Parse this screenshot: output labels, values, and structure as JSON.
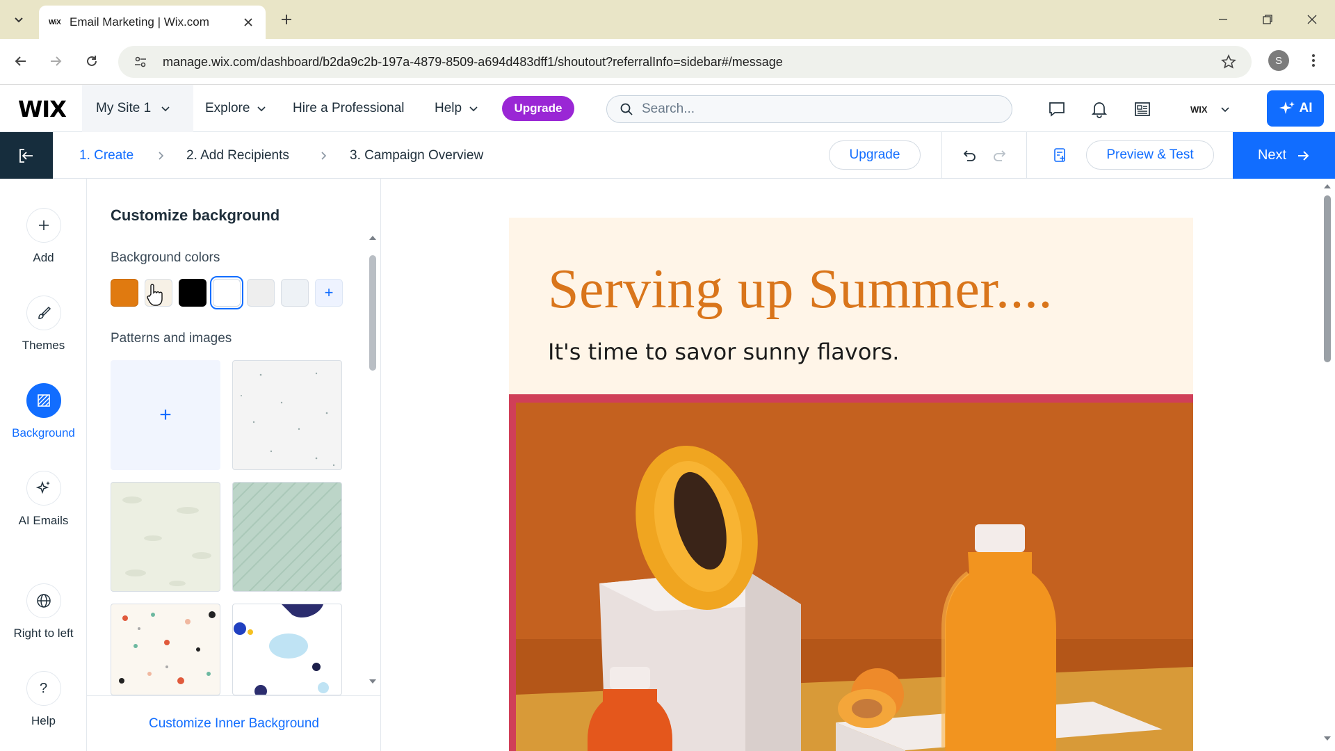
{
  "browser": {
    "tab_title": "Email Marketing | Wix.com",
    "tab_favicon": "WiX",
    "url": "manage.wix.com/dashboard/b2da9c2b-197a-4879-8509-a694d483dff1/shoutout?referralInfo=sidebar#/message",
    "profile_initial": "S"
  },
  "wix_topbar": {
    "logo": "WIX",
    "site_name": "My Site 1",
    "explore": "Explore",
    "hire": "Hire a Professional",
    "help": "Help",
    "upgrade": "Upgrade",
    "search_placeholder": "Search...",
    "account": "WIX",
    "ai_button": "AI"
  },
  "steps": {
    "create": "1. Create",
    "recipients": "2. Add Recipients",
    "overview": "3. Campaign Overview",
    "upgrade": "Upgrade",
    "preview": "Preview & Test",
    "next": "Next"
  },
  "left_rail": [
    {
      "label": "Add",
      "icon": "plus-icon"
    },
    {
      "label": "Themes",
      "icon": "brush-icon"
    },
    {
      "label": "Background",
      "icon": "background-icon",
      "active": true
    },
    {
      "label": "AI Emails",
      "icon": "sparkle-icon"
    },
    {
      "label": "Right to left",
      "icon": "globe-icon"
    },
    {
      "label": "Help",
      "icon": "question-icon"
    }
  ],
  "panel": {
    "title": "Customize background",
    "colors_label": "Background colors",
    "patterns_label": "Patterns and images",
    "footer_link": "Customize Inner Background",
    "swatches": [
      "#e07a10",
      "#f7f1e6",
      "#000000",
      "#ffffff",
      "#eeeeee",
      "#eef2f6"
    ],
    "selected_swatch": "#ffffff"
  },
  "email": {
    "heading": "Serving up Summer....",
    "subtitle": "It's time to savor sunny flavors."
  },
  "colors": {
    "accent": "#116dff",
    "upgrade_purple": "#9a27d5",
    "heading_orange": "#d9751b",
    "email_bg": "#fff5e8",
    "image_border": "#d03f58"
  }
}
